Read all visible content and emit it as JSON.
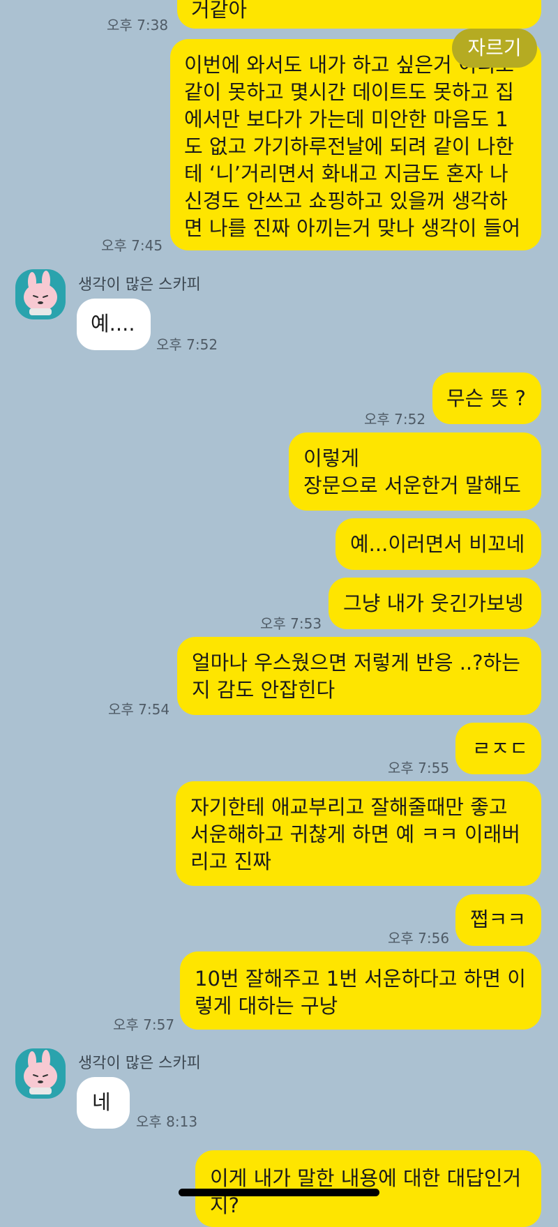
{
  "colors": {
    "background": "#abc1d1",
    "my_bubble": "#fee500",
    "their_bubble": "#ffffff",
    "cut_button": "#b5ab22"
  },
  "cut_button_label": "자르기",
  "sender_name": "생각이 많은 스카피",
  "messages": [
    {
      "from": "me",
      "text": "거같아",
      "time": "오후 7:38"
    },
    {
      "from": "me",
      "text": "이번에 와서도 내가 하고 싶은거 이리도\n같이 못하고 몇시간 데이트도 못하고 집\n에서만 보다가 가는데 미안한 마음도 1\n도 없고 가기하루전날에 되려 같이 나한\n테 ‘니’거리면서 화내고 지금도 혼자 나\n신경도 안쓰고 쇼핑하고 있을꺼 생각하\n면 나를 진짜 아끼는거 맞나 생각이 들어",
      "time": "오후 7:45"
    },
    {
      "from": "them",
      "text": "예....",
      "time": "오후 7:52"
    },
    {
      "from": "me",
      "text": "무슨 뜻 ?",
      "time": "오후 7:52"
    },
    {
      "from": "me",
      "text": "이렇게\n장문으로 서운한거 말해도",
      "time": ""
    },
    {
      "from": "me",
      "text": "예...이러면서 비꼬네",
      "time": ""
    },
    {
      "from": "me",
      "text": "그냥 내가 웃긴가보넹",
      "time": "오후 7:53"
    },
    {
      "from": "me",
      "text": "얼마나 우스웠으면 저렇게 반응 ..?하는\n지 감도 안잡힌다",
      "time": "오후 7:54"
    },
    {
      "from": "me",
      "text": "ㄹㅈㄷ",
      "time": "오후 7:55"
    },
    {
      "from": "me",
      "text": "자기한테 애교부리고 잘해줄때만 좋고\n서운해하고 귀찮게 하면 예 ㅋㅋ 이래버\n리고 진짜",
      "time": ""
    },
    {
      "from": "me",
      "text": "쩝ㅋㅋ",
      "time": "오후 7:56"
    },
    {
      "from": "me",
      "text": "10번 잘해주고 1번 서운하다고 하면 이\n렇게 대하는 구낭",
      "time": "오후 7:57"
    },
    {
      "from": "them",
      "text": "네",
      "time": "오후 8:13"
    },
    {
      "from": "me",
      "text": "이게 내가 말한 내용에 대한 대답인거\n지?",
      "time": ""
    }
  ]
}
